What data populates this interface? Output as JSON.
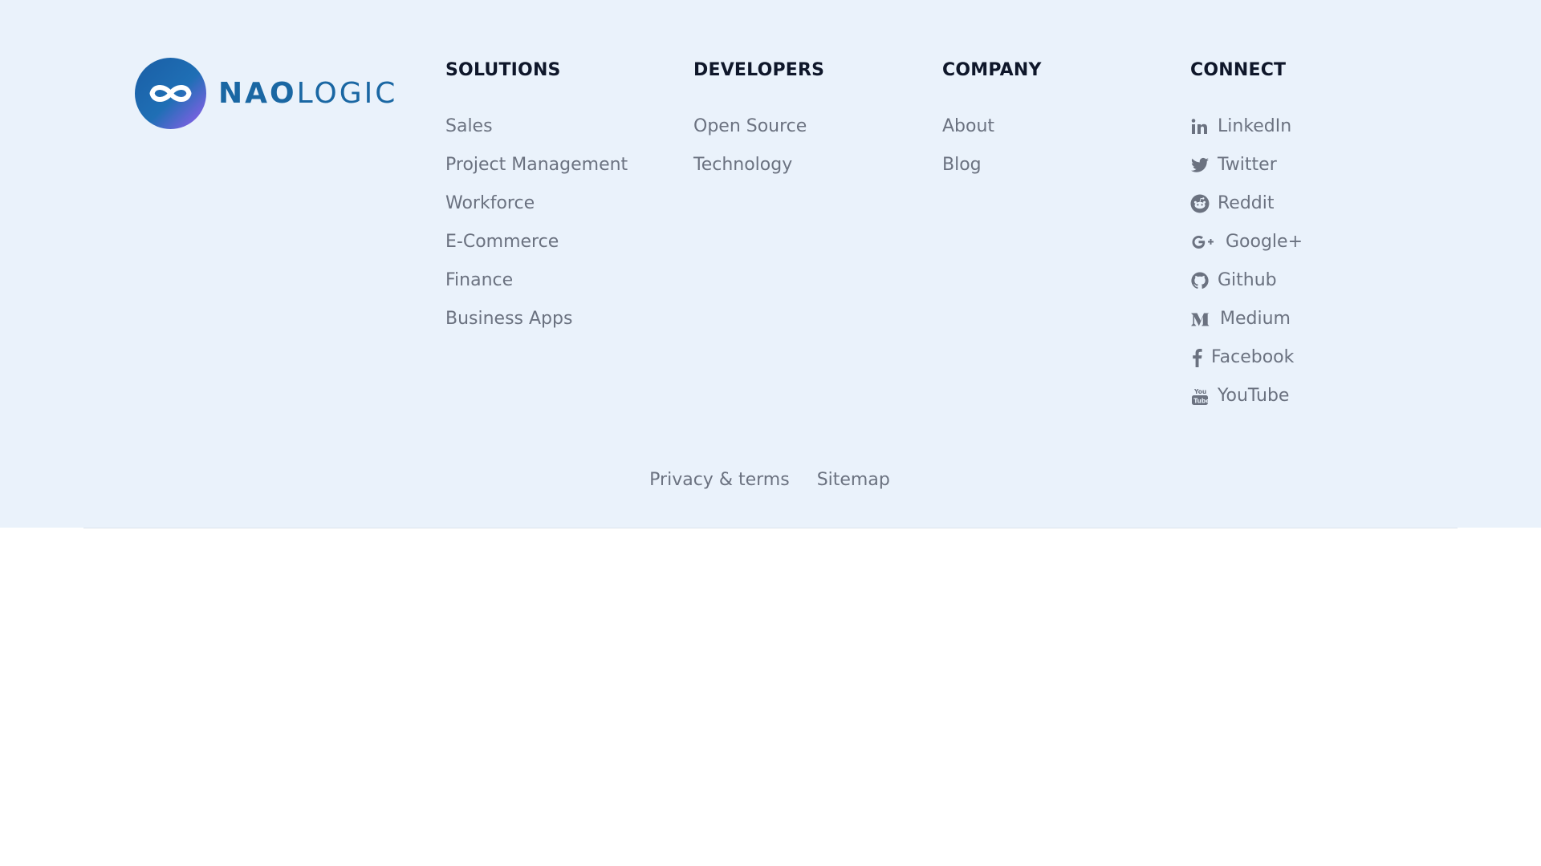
{
  "brand": {
    "name_bold": "NAO",
    "name_light": "LOGIC",
    "gradient_start": "#1a67a3",
    "gradient_end": "#8b5cf6"
  },
  "columns": {
    "solutions": {
      "heading": "SOLUTIONS",
      "links": [
        "Sales",
        "Project Management",
        "Workforce",
        "E-Commerce",
        "Finance",
        "Business Apps"
      ]
    },
    "developers": {
      "heading": "DEVELOPERS",
      "links": [
        "Open Source",
        "Technology"
      ]
    },
    "company": {
      "heading": "COMPANY",
      "links": [
        "About",
        "Blog"
      ]
    },
    "connect": {
      "heading": "CONNECT",
      "links": [
        {
          "label": "LinkedIn",
          "icon": "linkedin-icon"
        },
        {
          "label": "Twitter",
          "icon": "twitter-icon"
        },
        {
          "label": "Reddit",
          "icon": "reddit-icon"
        },
        {
          "label": "Google+",
          "icon": "google-plus-icon"
        },
        {
          "label": "Github",
          "icon": "github-icon"
        },
        {
          "label": "Medium",
          "icon": "medium-icon"
        },
        {
          "label": "Facebook",
          "icon": "facebook-icon"
        },
        {
          "label": "YouTube",
          "icon": "youtube-icon"
        }
      ]
    }
  },
  "bottom": {
    "privacy": "Privacy & terms",
    "sitemap": "Sitemap"
  },
  "colors": {
    "footer_bg": "#eaf2fb",
    "heading": "#0f172a",
    "link": "#6b7280",
    "brand_blue": "#1a67a3"
  }
}
